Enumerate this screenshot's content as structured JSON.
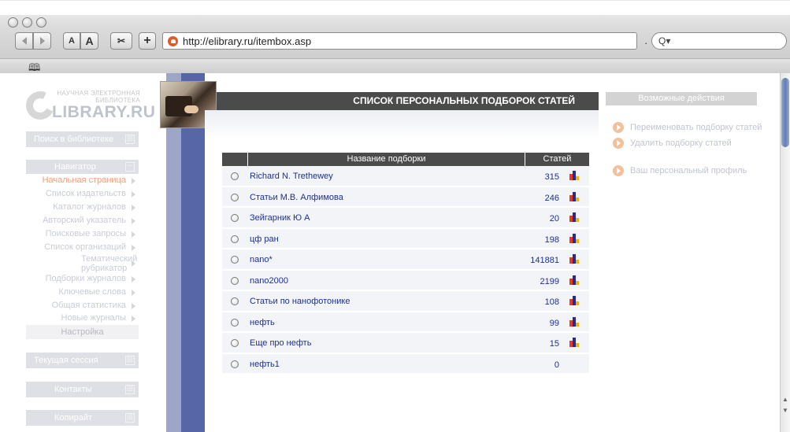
{
  "browser": {
    "url": "http://elibrary.ru/itembox.asp",
    "search_label": "Q▾",
    "text_smaller": "A",
    "text_larger": "A",
    "add_label": "+"
  },
  "logo": {
    "tagline_line1": "НАУЧНАЯ ЭЛЕКТРОННАЯ",
    "tagline_line2": "БИБЛИОТЕКА",
    "name": "LIBRARY.RU"
  },
  "sidebar": {
    "search_block": "Поиск в библиотеке",
    "navigator_block": "Навигатор",
    "items": [
      {
        "label": "Начальная страница"
      },
      {
        "label": "Список издательств"
      },
      {
        "label": "Каталог журналов"
      },
      {
        "label": "Авторский указатель"
      },
      {
        "label": "Поисковые запросы"
      },
      {
        "label": "Список организаций"
      },
      {
        "label": "Тематический рубрикатор"
      },
      {
        "label": "Подборки журналов"
      },
      {
        "label": "Ключевые слова"
      },
      {
        "label": "Общая статистика"
      },
      {
        "label": "Новые журналы"
      }
    ],
    "settings": "Настройка",
    "session_block": "Текущая сессия",
    "contacts_block": "Контакты",
    "copyright_block": "Копирайт",
    "expand_symbol": "⊞"
  },
  "main": {
    "title": "СПИСОК ПЕРСОНАЛЬНЫХ ПОДБОРОК СТАТЕЙ",
    "columns": {
      "name": "Название подборки",
      "count": "Статей"
    },
    "rows": [
      {
        "name": "Richard N. Trethewey",
        "count": "315",
        "chart": true
      },
      {
        "name": "Статьи М.В. Алфимова",
        "count": "246",
        "chart": true
      },
      {
        "name": "Зейгарник Ю А",
        "count": "20",
        "chart": true
      },
      {
        "name": "цф ран",
        "count": "198",
        "chart": true
      },
      {
        "name": "nano*",
        "count": "141881",
        "chart": true
      },
      {
        "name": "nano2000",
        "count": "2199",
        "chart": true
      },
      {
        "name": "Статьи по нанофотонике",
        "count": "108",
        "chart": true
      },
      {
        "name": "нефть",
        "count": "99",
        "chart": true
      },
      {
        "name": "Еще про нефть",
        "count": "15",
        "chart": true
      },
      {
        "name": "нефть1",
        "count": "0",
        "chart": false
      }
    ]
  },
  "actions": {
    "header": "Возможные действия",
    "items": [
      {
        "label": "Переименовать подборку статей"
      },
      {
        "label": "Удалить подборку статей"
      },
      {
        "label": "Ваш персональный профиль"
      }
    ]
  },
  "colors": {
    "nav_active": "#f2a07b",
    "link": "#1f2f8f",
    "stripe_dark": "#5666a6",
    "header_dark": "#4b4b4b"
  }
}
